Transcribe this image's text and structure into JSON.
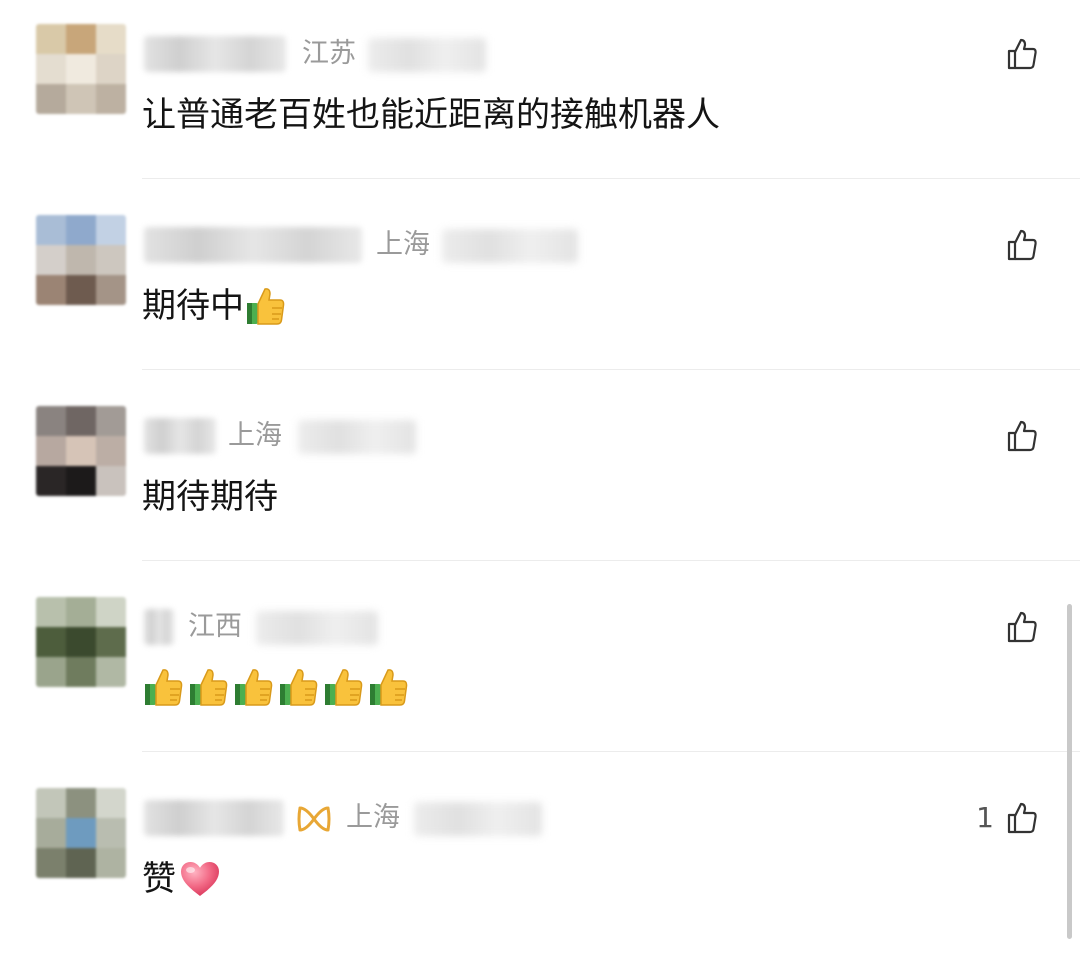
{
  "comments": [
    {
      "location": "江苏",
      "text": "让普通老百姓也能近距离的接触机器人",
      "emojis": [],
      "like_count": ""
    },
    {
      "location": "上海",
      "text": "期待中",
      "emojis": [
        "thumbs-up"
      ],
      "like_count": ""
    },
    {
      "location": "上海",
      "text": "期待期待",
      "emojis": [],
      "like_count": ""
    },
    {
      "location": "江西",
      "text": "",
      "emojis": [
        "thumbs-up",
        "thumbs-up",
        "thumbs-up",
        "thumbs-up",
        "thumbs-up",
        "thumbs-up"
      ],
      "like_count": ""
    },
    {
      "location": "上海",
      "text": "赞",
      "emojis": [
        "red-heart"
      ],
      "like_count": "1"
    }
  ],
  "icons": {
    "like": "thumbs-up-outline-icon",
    "badge": "gold-infinity-badge-icon"
  },
  "colors": {
    "location_text": "#9a9a9a",
    "divider": "#ececec",
    "badge": "#e8a735",
    "heart": "#f0506e"
  }
}
